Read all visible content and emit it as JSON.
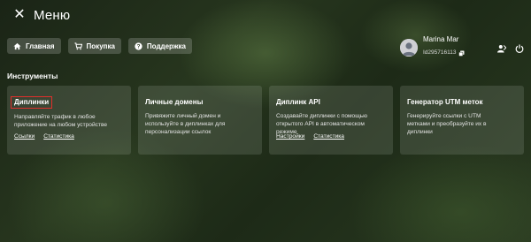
{
  "header": {
    "close_icon": "close-icon",
    "title": "Меню"
  },
  "nav": {
    "items": [
      {
        "label": "Главная",
        "icon": "home-icon"
      },
      {
        "label": "Покупка",
        "icon": "cart-icon"
      },
      {
        "label": "Поддержка",
        "icon": "help-icon"
      }
    ]
  },
  "user": {
    "name": "Marina Mar",
    "id": "Id295716113",
    "avatar_icon": "avatar-icon",
    "copy_icon": "copy-icon",
    "actions": [
      "switch-user-icon",
      "power-icon"
    ]
  },
  "tools": {
    "section_title": "Инструменты",
    "cards": [
      {
        "title": "Диплинки",
        "description": "Направляйте трафик в любое приложение на любом устройстве",
        "links": [
          "Ссылки",
          "Статистика"
        ]
      },
      {
        "title": "Личные домены",
        "description": "Привяжите личный домен и используйте в диплинках для персонализации ссылок",
        "links": []
      },
      {
        "title": "Диплинк API",
        "description": "Создавайте диплинки с помощью открытого API в автоматическом режиме",
        "links": [
          "Настройки",
          "Статистика"
        ]
      },
      {
        "title": "Генератор UTM меток",
        "description": "Генерируйте ссылки с UTM метками и преобразуйте их в диплинки",
        "links": []
      }
    ]
  },
  "colors": {
    "highlight_border": "#e0302c",
    "card_bg": "rgba(235,240,230,0.13)",
    "nav_btn_bg": "rgba(255,255,255,0.18)"
  }
}
